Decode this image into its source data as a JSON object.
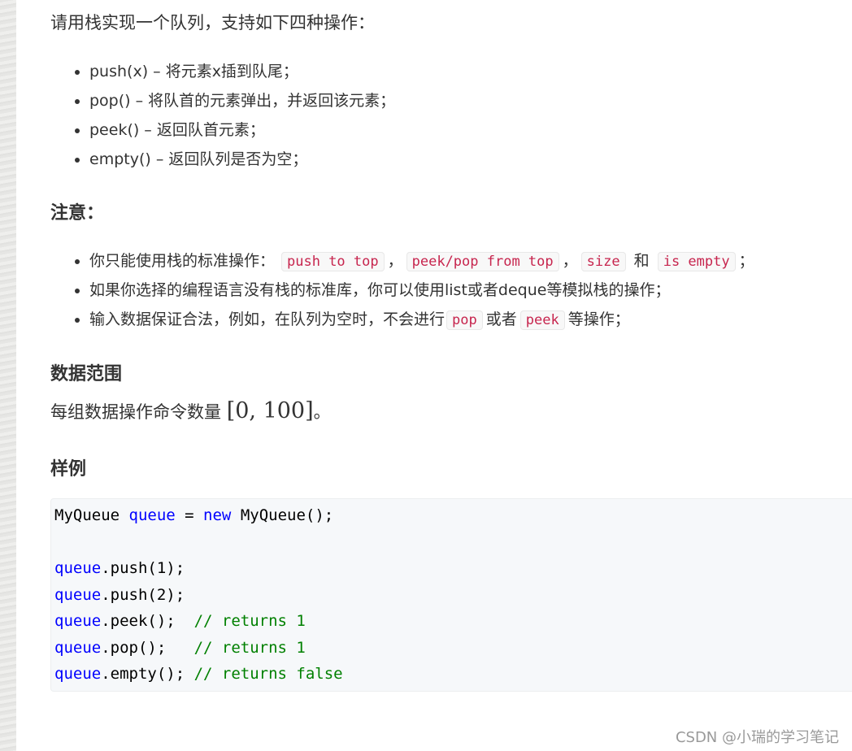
{
  "intro": "请用栈实现一个队列，支持如下四种操作：",
  "operations": [
    "push(x) – 将元素x插到队尾；",
    "pop() – 将队首的元素弹出，并返回该元素；",
    "peek() – 返回队首元素；",
    "empty() – 返回队列是否为空；"
  ],
  "note_heading": "注意：",
  "notes": {
    "n1": {
      "pre": "你只能使用栈的标准操作：",
      "c1": "push to top",
      "s1": "，",
      "c2": "peek/pop from top",
      "s2": "，",
      "c3": "size",
      "s3": "和",
      "c4": "is empty",
      "s4": "；"
    },
    "n2": "如果你选择的编程语言没有栈的标准库，你可以使用list或者deque等模拟栈的操作；",
    "n3": {
      "pre": "输入数据保证合法，例如，在队列为空时，不会进行",
      "c1": "pop",
      "mid": "或者",
      "c2": "peek",
      "post": "等操作；"
    }
  },
  "range_heading": "数据范围",
  "range_text": "每组数据操作命令数量",
  "range_math": "[0, 100]",
  "range_end": "。",
  "example_heading": "样例",
  "colors": {
    "plain": "#000000",
    "keyword": "#0000ff",
    "comment": "#008000",
    "inline_code": "#c7254e"
  },
  "code_lines": [
    [
      {
        "t": "MyQueue ",
        "c": "plain"
      },
      {
        "t": "queue",
        "c": "keyword"
      },
      {
        "t": " = ",
        "c": "plain"
      },
      {
        "t": "new",
        "c": "keyword"
      },
      {
        "t": " MyQueue();",
        "c": "plain"
      }
    ],
    [],
    [
      {
        "t": "queue",
        "c": "keyword"
      },
      {
        "t": ".push(1);",
        "c": "plain"
      }
    ],
    [
      {
        "t": "queue",
        "c": "keyword"
      },
      {
        "t": ".push(2);",
        "c": "plain"
      }
    ],
    [
      {
        "t": "queue",
        "c": "keyword"
      },
      {
        "t": ".peek();  ",
        "c": "plain"
      },
      {
        "t": "// returns 1",
        "c": "comment"
      }
    ],
    [
      {
        "t": "queue",
        "c": "keyword"
      },
      {
        "t": ".pop();   ",
        "c": "plain"
      },
      {
        "t": "// returns 1",
        "c": "comment"
      }
    ],
    [
      {
        "t": "queue",
        "c": "keyword"
      },
      {
        "t": ".empty(); ",
        "c": "plain"
      },
      {
        "t": "// returns false",
        "c": "comment"
      }
    ]
  ],
  "watermark": "CSDN @小瑞的学习笔记"
}
